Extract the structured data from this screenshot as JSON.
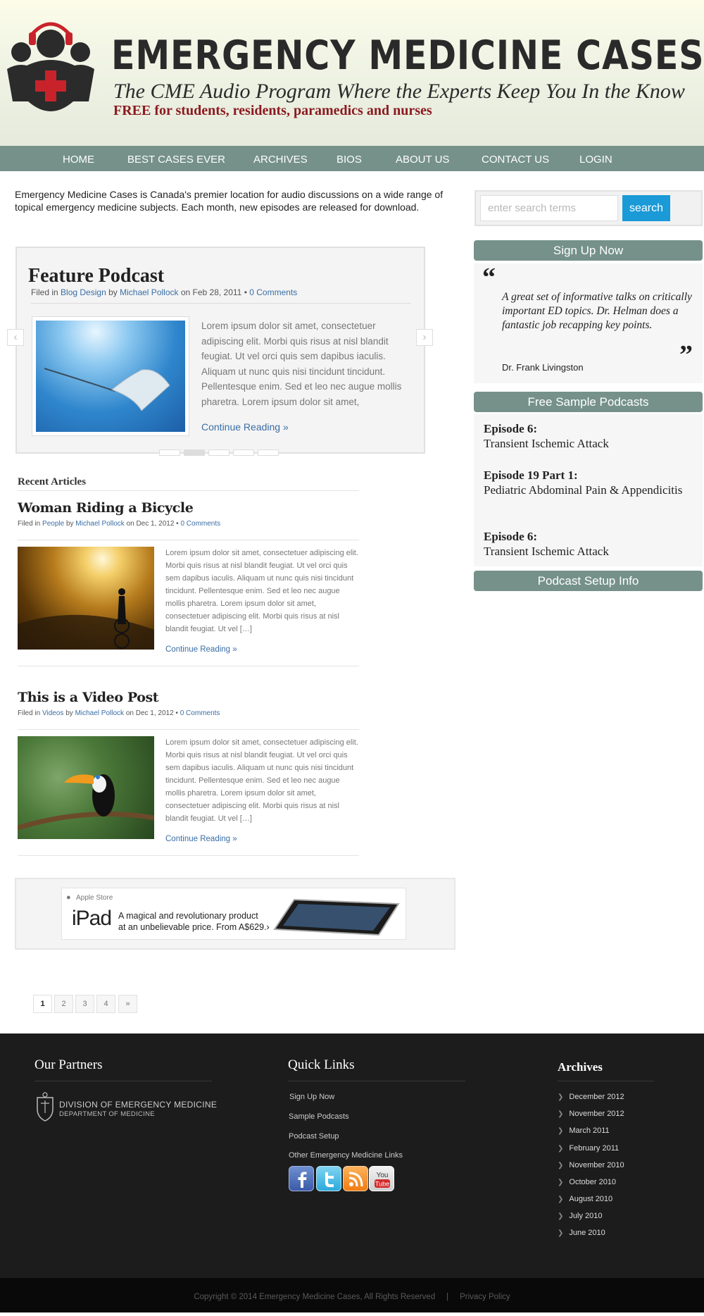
{
  "header": {
    "title": "EMERGENCY MEDICINE CASES",
    "tagline": "The CME Audio Program Where the Experts Keep You In the Know",
    "subtagline": "FREE for students, residents, paramedics and nurses"
  },
  "nav": {
    "items": [
      "HOME",
      "BEST CASES EVER",
      "ARCHIVES",
      "BIOS",
      "ABOUT US",
      "CONTACT US",
      "LOGIN"
    ]
  },
  "intro": {
    "text": "Emergency Medicine Cases is Canada's premier location for audio discussions on a wide range of topical emergency medicine subjects. Each month, new episodes are released for download."
  },
  "feature": {
    "title": "Feature Podcast",
    "filed_in": "Filed in",
    "category": "Blog Design",
    "by": "by",
    "author": "Michael Pollock",
    "date": "on Feb 28, 2011 •",
    "comments": "0 Comments",
    "text": "Lorem ipsum dolor sit amet, consectetuer adipiscing elit. Morbi quis risus at nisl blandit feugiat. Ut vel orci quis sem dapibus iaculis. Aliquam ut nunc quis nisi tincidunt tincidunt. Pellentesque enim. Sed et leo nec augue mollis pharetra. Lorem ipsum dolor sit amet,",
    "continue": "Continue Reading »",
    "prev_arrow": "‹",
    "next_arrow": "›",
    "active_slide": 2,
    "slide_count": 5
  },
  "recent": {
    "heading": "Recent Articles",
    "posts": [
      {
        "title": "Woman Riding a Bicycle",
        "filed_in": "Filed in",
        "category": "People",
        "by": "by",
        "author": "Michael Pollock",
        "date": "on Dec 1, 2012 •",
        "comments": "0 Comments",
        "text": "Lorem ipsum dolor sit amet, consectetuer adipiscing elit. Morbi quis risus at nisl blandit feugiat. Ut vel orci quis sem dapibus iaculis. Aliquam ut nunc quis nisi tincidunt tincidunt. Pellentesque enim. Sed et leo nec augue mollis pharetra. Lorem ipsum dolor sit amet, consectetuer adipiscing elit. Morbi quis risus at nisl blandit feugiat. Ut vel […]",
        "continue": "Continue Reading »"
      },
      {
        "title": "This is a Video Post",
        "filed_in": "Filed in",
        "category": "Videos",
        "by": "by",
        "author": "Michael Pollock",
        "date": "on Dec 1, 2012 •",
        "comments": "0 Comments",
        "text": "Lorem ipsum dolor sit amet, consectetuer adipiscing elit. Morbi quis risus at nisl blandit feugiat. Ut vel orci quis sem dapibus iaculis. Aliquam ut nunc quis nisi tincidunt tincidunt. Pellentesque enim. Sed et leo nec augue mollis pharetra. Lorem ipsum dolor sit amet, consectetuer adipiscing elit. Morbi quis risus at nisl blandit feugiat. Ut vel […]",
        "continue": "Continue Reading »"
      }
    ]
  },
  "ad": {
    "store": "Apple Store",
    "product": "iPad",
    "line1": "A magical and revolutionary product",
    "line2": "at an unbelievable price. From A$629.›"
  },
  "pagination": {
    "pages": [
      "1",
      "2",
      "3",
      "4",
      "»"
    ],
    "current": "1"
  },
  "sidebar": {
    "search_placeholder": "enter search terms",
    "search_button": "search",
    "signup_title": "Sign Up Now",
    "quote_open": "“",
    "quote_close": "”",
    "quote_text": "A great set of informative talks on critically important ED topics. Dr. Helman does a fantastic job recapping key points.",
    "quote_author": "Dr. Frank Livingston",
    "samples_title": "Free Sample Podcasts",
    "samples": [
      {
        "episode": "Episode 6:",
        "topic": "Transient Ischemic Attack"
      },
      {
        "episode": "Episode 19 Part 1:",
        "topic": "Pediatric Abdominal Pain & Appendicitis"
      },
      {
        "episode": "Episode 6:",
        "topic": "Transient Ischemic Attack"
      }
    ],
    "setup_title": "Podcast Setup Info"
  },
  "footer": {
    "partners_heading": "Our Partners",
    "partner_line1": "DIVISION OF EMERGENCY MEDICINE",
    "partner_line2": "DEPARTMENT OF MEDICINE",
    "quicklinks_heading": "Quick Links",
    "quicklinks": [
      "Sign Up Now",
      "Sample Podcasts",
      "Podcast Setup",
      "Other Emergency Medicine Links"
    ],
    "archives_heading": "Archives",
    "archives": [
      "December 2012",
      "November 2012",
      "March 2011",
      "February 2011",
      "November 2010",
      "October 2010",
      "August 2010",
      "July 2010",
      "June 2010"
    ],
    "copyright": "Copyright © 2014 Emergency Medicine Cases, All Rights Reserved",
    "separator": "|",
    "privacy": "Privacy Policy"
  },
  "colors": {
    "nav_bg": "#75918a",
    "link": "#3a6ea5",
    "search_button": "#1a9ad7",
    "logo_red": "#c8232b",
    "footer_bg": "#1c1c1c"
  }
}
